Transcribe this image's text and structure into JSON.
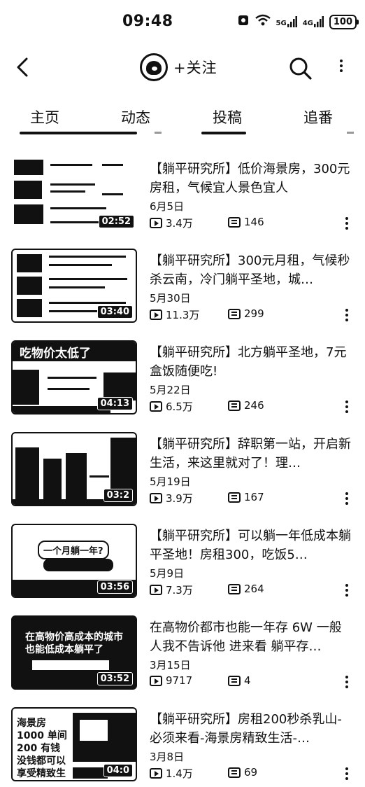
{
  "status_bar": {
    "time": "09:48",
    "net1": "5G",
    "net2": "4G",
    "battery": "100"
  },
  "header": {
    "follow_label": "+关注"
  },
  "tabs": [
    {
      "label": "主页"
    },
    {
      "label": "动态"
    },
    {
      "label": "投稿"
    },
    {
      "label": "追番"
    }
  ],
  "videos": [
    {
      "title": "【躺平研究所】低价海景房，300元房租，气候宜人景色宜人",
      "date": "6月5日",
      "plays": "3.4万",
      "danmaku": "146",
      "duration": "02:52"
    },
    {
      "title": "【躺平研究所】300元月租，气候秒杀云南，冷门躺平圣地，城…",
      "date": "5月30日",
      "plays": "11.3万",
      "danmaku": "299",
      "duration": "03:40"
    },
    {
      "title": "【躺平研究所】北方躺平圣地，7元盒饭随便吃!",
      "date": "5月22日",
      "plays": "6.5万",
      "danmaku": "246",
      "duration": "04:13"
    },
    {
      "title": "【躺平研究所】辞职第一站，开启新生活，来这里就对了！理…",
      "date": "5月19日",
      "plays": "3.9万",
      "danmaku": "167",
      "duration": "03:2"
    },
    {
      "title": "【躺平研究所】可以躺一年低成本躺平圣地！房租300，吃饭5…",
      "date": "5月9日",
      "plays": "7.3万",
      "danmaku": "264",
      "duration": "03:56"
    },
    {
      "title": "在高物价都市也能一年存 6W 一般人我不告诉他 进来看 躺平存…",
      "date": "3月15日",
      "plays": "9717",
      "danmaku": "4",
      "duration": "03:52"
    },
    {
      "title": "【躺平研究所】房租200秒杀乳山-必须来看-海景房精致生活-…",
      "date": "3月8日",
      "plays": "1.4万",
      "danmaku": "69",
      "duration": "04:0"
    }
  ],
  "thumb_texts": {
    "v3": "吃物价太低了",
    "v5": "一个月躺一年?",
    "v6": "在高物价高成本的城市也能低成本躺平了",
    "v7": "海景房1000 单间200 有钱没钱都可以享受精致生活"
  }
}
